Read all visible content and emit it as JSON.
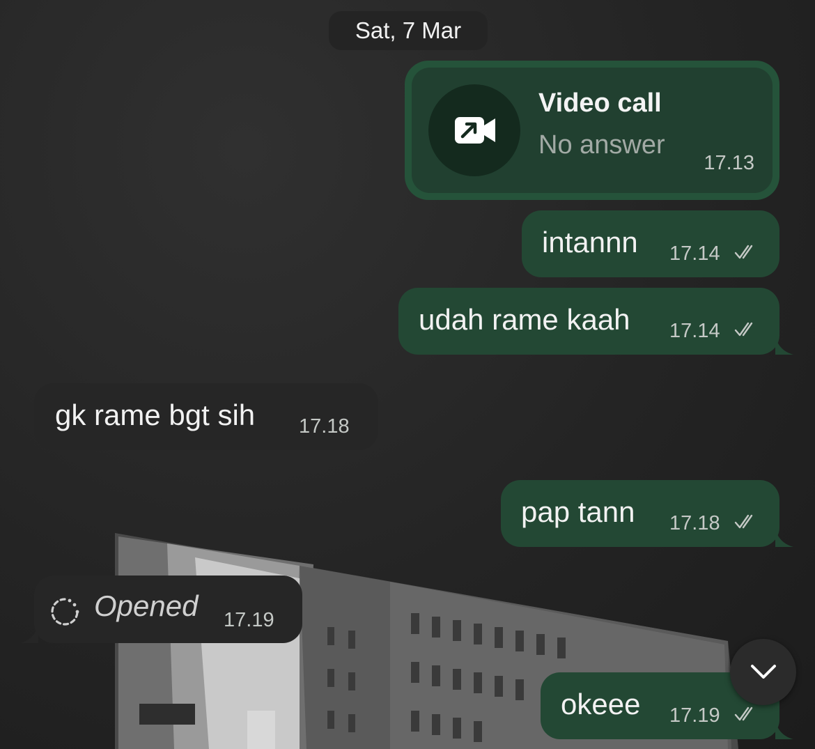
{
  "date_header": "Sat, 7 Mar",
  "call": {
    "title": "Video call",
    "status": "No answer",
    "time": "17.13"
  },
  "messages": [
    {
      "direction": "outgoing",
      "text": "intannn",
      "time": "17.14",
      "read": true
    },
    {
      "direction": "outgoing",
      "text": "udah rame kaah",
      "time": "17.14",
      "read": true
    },
    {
      "direction": "incoming",
      "text": "gk rame bgt sih",
      "time": "17.18"
    },
    {
      "direction": "outgoing",
      "text": "pap tann",
      "time": "17.18",
      "read": true
    },
    {
      "direction": "incoming",
      "text": "Opened",
      "time": "17.19",
      "kind": "view-once-opened"
    },
    {
      "direction": "outgoing",
      "text": "okeee",
      "time": "17.19",
      "read": true
    }
  ],
  "colors": {
    "outgoing_bubble": "#234834",
    "incoming_bubble": "#262626",
    "background": "#242424"
  },
  "icons": {
    "call": "video-call-outgoing-icon",
    "read_receipt": "double-check-icon",
    "view_once": "view-once-opened-icon",
    "scroll": "chevron-down-icon"
  }
}
